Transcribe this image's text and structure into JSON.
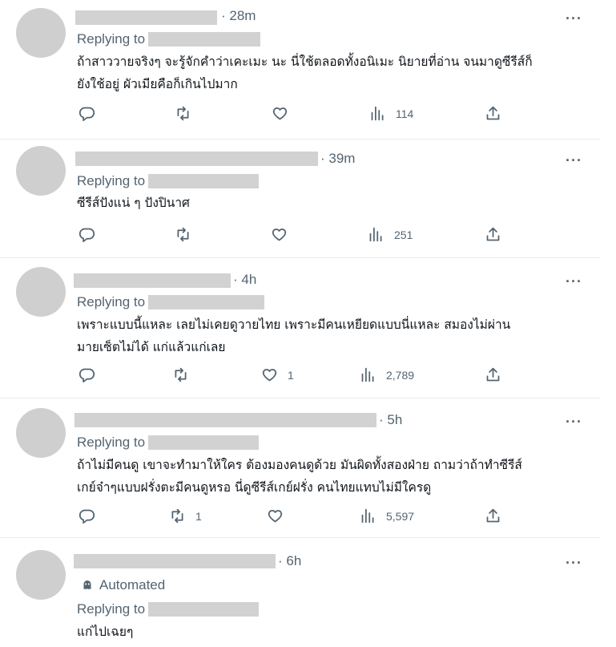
{
  "tweets": [
    {
      "time": "28m",
      "replying_label": "Replying to",
      "text_lines": [
        "ถ้าสาววายจริงๆ จะรู้จักคำว่าเคะเมะ นะ นี่ใช้ตลอดทั้งอนิเมะ นิยายที่อ่าน จนมาดูซีรีส์ก็",
        "ยังใช้อยู่ ผัวเมียคือก็เกินไปมาก"
      ],
      "retweets": "",
      "likes": "",
      "views": "114"
    },
    {
      "time": "39m",
      "replying_label": "Replying to",
      "text_lines": [
        "ซีรีส์ปังแน่ ๆ ปังปินาศ"
      ],
      "retweets": "",
      "likes": "",
      "views": "251"
    },
    {
      "time": "4h",
      "replying_label": "Replying to",
      "text_lines": [
        "เพราะแบบนี้แหละ เลยไม่เคยดูวายไทย   เพราะมีคนเหยียดแบบนี่แหละ สมองไม่ผ่าน",
        "มายเซ็ตไม่ได้  แก่แล้วแก่เลย"
      ],
      "retweets": "",
      "likes": "1",
      "views": "2,789"
    },
    {
      "time": "5h",
      "replying_label": "Replying to",
      "text_lines": [
        "ถ้าไม่มีคนดู เขาจะทำมาให้ใคร ต้องมองคนดูด้วย มันผิดทั้งสองฝ่าย ถามว่าถ้าทำซีรีส์",
        "เกย์จ๋าๆแบบฝรั่งตะมีคนดูหรอ นี่ดูซีรีส์เกย์ฝรั่ง คนไทยแทบไม่มีใครดู"
      ],
      "retweets": "1",
      "likes": "",
      "views": "5,597"
    },
    {
      "time": "6h",
      "automated_label": "Automated",
      "replying_label": "Replying to",
      "text_lines": [
        "แก่ไปเฉยๆ"
      ]
    }
  ],
  "icons": {
    "reply": "reply-icon",
    "retweet": "retweet-icon",
    "like": "heart-icon",
    "views": "views-icon",
    "share": "share-icon",
    "more": "more-icon",
    "automated": "robot-icon"
  },
  "colors": {
    "secondary_text": "#536471",
    "placeholder": "#d2d2d2",
    "divider": "#e6ecf0"
  }
}
